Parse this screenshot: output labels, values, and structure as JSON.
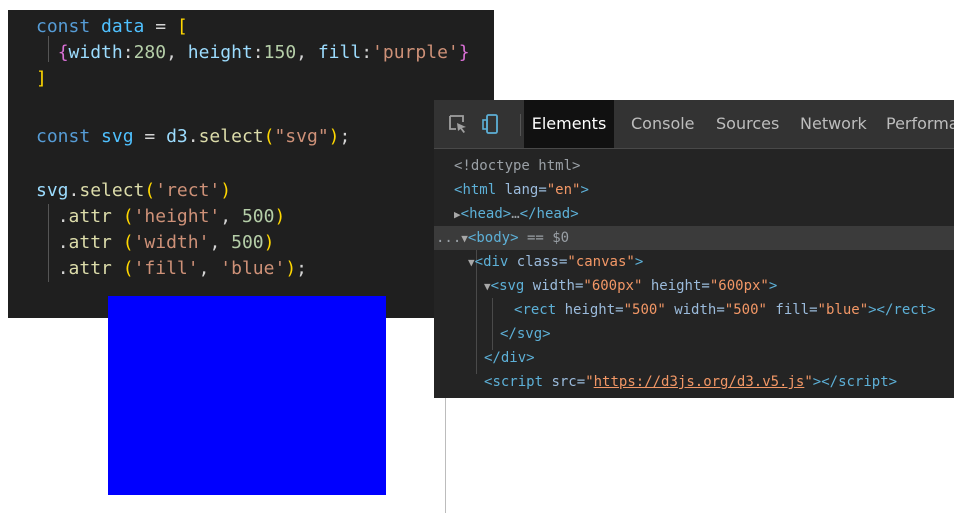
{
  "editor": {
    "lines": [
      {
        "kw": "const",
        "name": "data",
        "op": " = ",
        "bracket": "["
      },
      {
        "brace_open": "{",
        "k1": "width",
        "v1": "280",
        "k2": "height",
        "v2": "150",
        "k3": "fill",
        "v3": "'purple'",
        "brace_close": "}"
      },
      {
        "bracket": "]"
      },
      {
        "kw": "const",
        "name": "svg",
        "op": " = ",
        "obj": "d3",
        "method": "select",
        "arg": "\"svg\"",
        "end": ";"
      },
      {
        "obj": "svg",
        "method": "select",
        "arg": "'rect'"
      },
      {
        "method": "attr",
        "arg1": "'height'",
        "arg2": "500"
      },
      {
        "method": "attr",
        "arg1": "'width'",
        "arg2": "500"
      },
      {
        "method": "attr",
        "arg1": "'fill'",
        "arg2": "'blue'",
        "end": ";"
      }
    ]
  },
  "rendered": {
    "fill": "#0000ff"
  },
  "devtools": {
    "tabs": [
      "Elements",
      "Console",
      "Sources",
      "Network",
      "Performar"
    ],
    "active_tab": "Elements",
    "icons": [
      "inspect-element-icon",
      "device-toolbar-icon"
    ],
    "dom": {
      "doctype": "<!doctype html>",
      "html_tag": "html",
      "html_attr": "lang",
      "html_val": "\"en\"",
      "head_tag": "head",
      "head_ellipsis": "…",
      "body_prefix": "...",
      "body_tag": "body",
      "body_suffix": " == $0",
      "div_tag": "div",
      "div_attr": "class",
      "div_val": "\"canvas\"",
      "svg_tag": "svg",
      "svg_attr1": "width",
      "svg_val1": "\"600px\"",
      "svg_attr2": "height",
      "svg_val2": "\"600px\"",
      "rect_tag": "rect",
      "rect_attr1": "height",
      "rect_val1": "\"500\"",
      "rect_attr2": "width",
      "rect_val2": "\"500\"",
      "rect_attr3": "fill",
      "rect_val3": "\"blue\"",
      "script_tag": "script",
      "script_attr": "src",
      "script_url": "https://d3js.org/d3.v5.js"
    }
  }
}
